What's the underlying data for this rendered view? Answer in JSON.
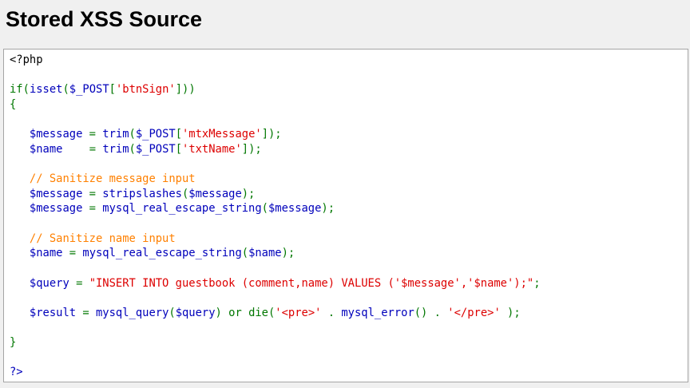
{
  "page": {
    "title": "Stored XSS Source"
  },
  "colors": {
    "plain": "#000000",
    "keyword": "#007700",
    "variable": "#0000bb",
    "string": "#dd0000",
    "comment": "#ff8000"
  },
  "code": {
    "lines": [
      [
        {
          "t": "<?php",
          "c": "plain"
        }
      ],
      [],
      [
        {
          "t": "if",
          "c": "keyword"
        },
        {
          "t": "(",
          "c": "keyword"
        },
        {
          "t": "isset",
          "c": "variable"
        },
        {
          "t": "(",
          "c": "keyword"
        },
        {
          "t": "$_POST",
          "c": "variable"
        },
        {
          "t": "[",
          "c": "keyword"
        },
        {
          "t": "'btnSign'",
          "c": "string"
        },
        {
          "t": "]))",
          "c": "keyword"
        }
      ],
      [
        {
          "t": "{",
          "c": "keyword"
        }
      ],
      [],
      [
        {
          "t": "   ",
          "c": "plain"
        },
        {
          "t": "$message",
          "c": "variable"
        },
        {
          "t": " = ",
          "c": "keyword"
        },
        {
          "t": "trim",
          "c": "variable"
        },
        {
          "t": "(",
          "c": "keyword"
        },
        {
          "t": "$_POST",
          "c": "variable"
        },
        {
          "t": "[",
          "c": "keyword"
        },
        {
          "t": "'mtxMessage'",
          "c": "string"
        },
        {
          "t": "]);",
          "c": "keyword"
        }
      ],
      [
        {
          "t": "   ",
          "c": "plain"
        },
        {
          "t": "$name",
          "c": "variable"
        },
        {
          "t": "    = ",
          "c": "keyword"
        },
        {
          "t": "trim",
          "c": "variable"
        },
        {
          "t": "(",
          "c": "keyword"
        },
        {
          "t": "$_POST",
          "c": "variable"
        },
        {
          "t": "[",
          "c": "keyword"
        },
        {
          "t": "'txtName'",
          "c": "string"
        },
        {
          "t": "]);",
          "c": "keyword"
        }
      ],
      [],
      [
        {
          "t": "   ",
          "c": "plain"
        },
        {
          "t": "// Sanitize message input",
          "c": "comment"
        }
      ],
      [
        {
          "t": "   ",
          "c": "plain"
        },
        {
          "t": "$message",
          "c": "variable"
        },
        {
          "t": " = ",
          "c": "keyword"
        },
        {
          "t": "stripslashes",
          "c": "variable"
        },
        {
          "t": "(",
          "c": "keyword"
        },
        {
          "t": "$message",
          "c": "variable"
        },
        {
          "t": ");",
          "c": "keyword"
        }
      ],
      [
        {
          "t": "   ",
          "c": "plain"
        },
        {
          "t": "$message",
          "c": "variable"
        },
        {
          "t": " = ",
          "c": "keyword"
        },
        {
          "t": "mysql_real_escape_string",
          "c": "variable"
        },
        {
          "t": "(",
          "c": "keyword"
        },
        {
          "t": "$message",
          "c": "variable"
        },
        {
          "t": ");",
          "c": "keyword"
        }
      ],
      [],
      [
        {
          "t": "   ",
          "c": "plain"
        },
        {
          "t": "// Sanitize name input",
          "c": "comment"
        }
      ],
      [
        {
          "t": "   ",
          "c": "plain"
        },
        {
          "t": "$name",
          "c": "variable"
        },
        {
          "t": " = ",
          "c": "keyword"
        },
        {
          "t": "mysql_real_escape_string",
          "c": "variable"
        },
        {
          "t": "(",
          "c": "keyword"
        },
        {
          "t": "$name",
          "c": "variable"
        },
        {
          "t": ");",
          "c": "keyword"
        }
      ],
      [],
      [
        {
          "t": "   ",
          "c": "plain"
        },
        {
          "t": "$query",
          "c": "variable"
        },
        {
          "t": " = ",
          "c": "keyword"
        },
        {
          "t": "\"INSERT INTO guestbook (comment,name) VALUES ('$message','$name');\"",
          "c": "string"
        },
        {
          "t": ";",
          "c": "keyword"
        }
      ],
      [],
      [
        {
          "t": "   ",
          "c": "plain"
        },
        {
          "t": "$result",
          "c": "variable"
        },
        {
          "t": " = ",
          "c": "keyword"
        },
        {
          "t": "mysql_query",
          "c": "variable"
        },
        {
          "t": "(",
          "c": "keyword"
        },
        {
          "t": "$query",
          "c": "variable"
        },
        {
          "t": ") or die(",
          "c": "keyword"
        },
        {
          "t": "'<pre>'",
          "c": "string"
        },
        {
          "t": " . ",
          "c": "keyword"
        },
        {
          "t": "mysql_error",
          "c": "variable"
        },
        {
          "t": "() . ",
          "c": "keyword"
        },
        {
          "t": "'</pre>'",
          "c": "string"
        },
        {
          "t": " );",
          "c": "keyword"
        }
      ],
      [],
      [
        {
          "t": "}",
          "c": "keyword"
        }
      ],
      [],
      [
        {
          "t": "?>",
          "c": "variable"
        }
      ]
    ]
  }
}
